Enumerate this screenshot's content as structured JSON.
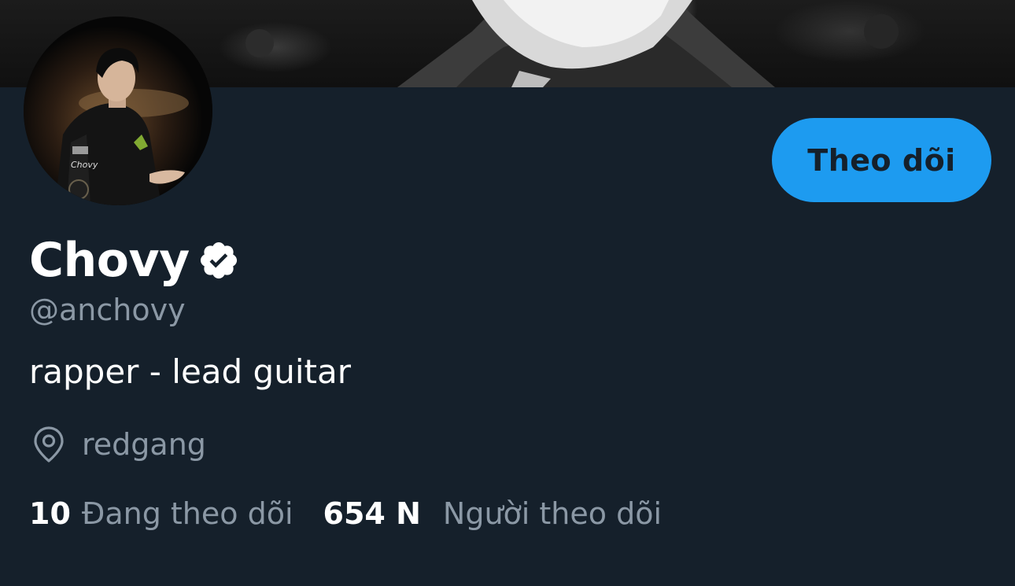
{
  "profile": {
    "display_name": "Chovy",
    "verified": true,
    "handle": "@anchovy",
    "bio": "rapper - lead guitar",
    "location": "redgang"
  },
  "actions": {
    "follow_label": "Theo dõi"
  },
  "stats": {
    "following_count": "10",
    "following_label": "Đang theo dõi",
    "followers_count": "654 N",
    "followers_label": "Người theo dõi"
  },
  "icons": {
    "verified": "verified-badge-icon",
    "location": "location-pin-icon"
  },
  "colors": {
    "background": "#15202b",
    "accent": "#1d9bf0",
    "primary_text": "#ffffff",
    "secondary_text": "#8b98a5"
  }
}
